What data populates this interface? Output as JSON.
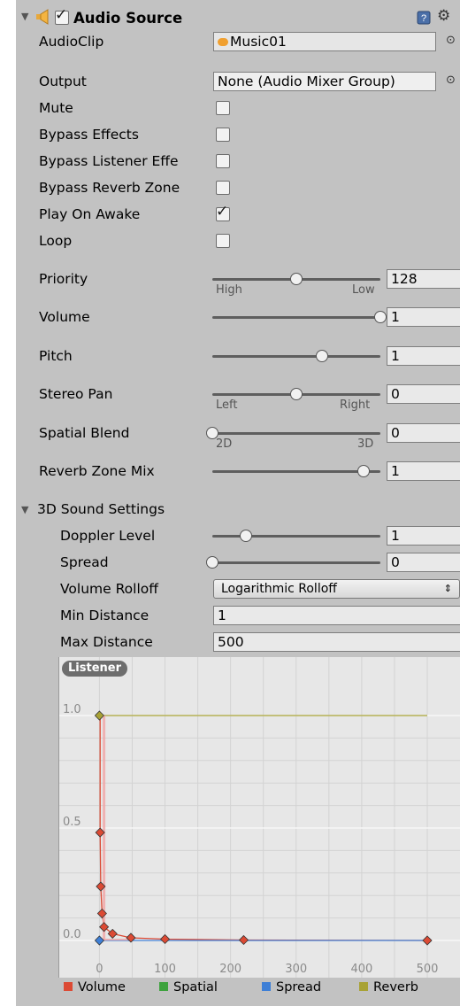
{
  "header": {
    "title": "Audio Source",
    "enabled": true,
    "help_icon": "help-book-icon",
    "settings_icon": "gear-icon"
  },
  "audio_clip": {
    "label": "AudioClip",
    "value": "Music01",
    "icon": "audio-clip-icon"
  },
  "output": {
    "label": "Output",
    "value": "None (Audio Mixer Group)"
  },
  "toggles": [
    {
      "label": "Mute",
      "checked": false
    },
    {
      "label": "Bypass Effects",
      "checked": false
    },
    {
      "label": "Bypass Listener Effe",
      "checked": false
    },
    {
      "label": "Bypass Reverb Zone",
      "checked": false
    },
    {
      "label": "Play On Awake",
      "checked": true
    },
    {
      "label": "Loop",
      "checked": false
    }
  ],
  "priority": {
    "label": "Priority",
    "value": "128",
    "fraction": 0.5,
    "min_label": "High",
    "max_label": "Low"
  },
  "volume": {
    "label": "Volume",
    "value": "1",
    "fraction": 1.0
  },
  "pitch": {
    "label": "Pitch",
    "value": "1",
    "fraction": 0.65
  },
  "stereo_pan": {
    "label": "Stereo Pan",
    "value": "0",
    "fraction": 0.5,
    "min_label": "Left",
    "max_label": "Right"
  },
  "spatial_blend": {
    "label": "Spatial Blend",
    "value": "0",
    "fraction": 0.0,
    "min_label": "2D",
    "max_label": "3D"
  },
  "reverb_zone_mix": {
    "label": "Reverb Zone Mix",
    "value": "1",
    "fraction": 0.9
  },
  "sound3d": {
    "title": "3D Sound Settings",
    "doppler": {
      "label": "Doppler Level",
      "value": "1",
      "fraction": 0.2
    },
    "spread": {
      "label": "Spread",
      "value": "0",
      "fraction": 0.0
    },
    "rolloff": {
      "label": "Volume Rolloff",
      "value": "Logarithmic Rolloff"
    },
    "min_distance": {
      "label": "Min Distance",
      "value": "1"
    },
    "max_distance": {
      "label": "Max Distance",
      "value": "500"
    }
  },
  "chart_data": {
    "type": "line",
    "badge": "Listener",
    "xlim": [
      -10,
      500
    ],
    "ylim": [
      0,
      1
    ],
    "x_ticks": [
      0,
      100,
      200,
      300,
      400,
      500
    ],
    "y_ticks": [
      0.0,
      0.5,
      1.0
    ],
    "y_tick_labels": [
      "0.0",
      "0.5",
      "1.0"
    ],
    "grid": true,
    "legend_position": "bottom",
    "series": [
      {
        "name": "Volume",
        "color": "#dc4a34",
        "points": [
          [
            0,
            1.0
          ],
          [
            1,
            1.0
          ],
          [
            1,
            0.48
          ],
          [
            2,
            0.24
          ],
          [
            4,
            0.12
          ],
          [
            7,
            0.06
          ],
          [
            20,
            0.03
          ],
          [
            48,
            0.012
          ],
          [
            100,
            0.006
          ],
          [
            220,
            0.002
          ],
          [
            500,
            0.0
          ]
        ],
        "keys": [
          [
            1,
            0.48
          ],
          [
            2,
            0.24
          ],
          [
            4,
            0.12
          ],
          [
            7,
            0.06
          ],
          [
            20,
            0.03
          ],
          [
            48,
            0.012
          ],
          [
            100,
            0.006
          ],
          [
            220,
            0.002
          ],
          [
            500,
            0.0
          ]
        ]
      },
      {
        "name": "Spatial",
        "color": "#3ea23e",
        "points": [],
        "keys": []
      },
      {
        "name": "Spread",
        "color": "#3e7fd6",
        "points": [
          [
            0,
            0.0
          ],
          [
            500,
            0.0
          ]
        ],
        "keys": [
          [
            0,
            0.0
          ]
        ]
      },
      {
        "name": "Reverb",
        "color": "#a8a235",
        "points": [
          [
            0,
            1.0
          ],
          [
            500,
            1.0
          ]
        ],
        "keys": [
          [
            0,
            1.0
          ]
        ]
      }
    ]
  }
}
